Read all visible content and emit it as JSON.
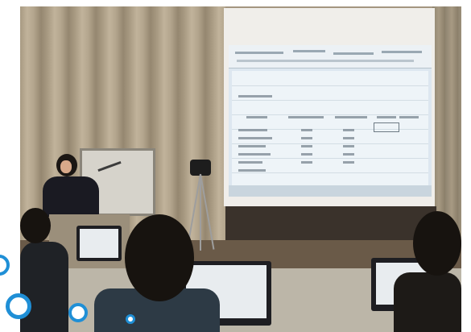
{
  "colors": {
    "accent_ring": "#1f8fd6",
    "screen_glow": "#dde7f0",
    "curtain": "#b3a58d"
  },
  "icons": {
    "decor_rings": [
      "circle-ring-icon",
      "circle-ring-icon",
      "circle-ring-icon",
      "circle-dot-icon"
    ]
  }
}
